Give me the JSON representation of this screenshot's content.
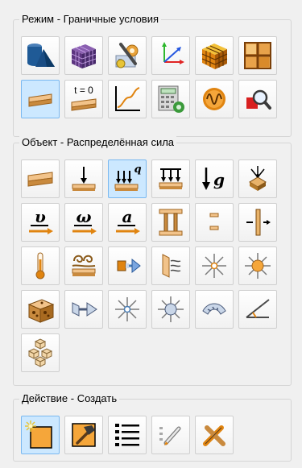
{
  "groups": {
    "mode": {
      "title": "Режим - Граничные условия",
      "buttons": [
        {
          "icon": "geometry-icon"
        },
        {
          "icon": "mesh-icon"
        },
        {
          "icon": "materials-icon"
        },
        {
          "icon": "coordinate-system-icon"
        },
        {
          "icon": "physics-cube-icon"
        },
        {
          "icon": "structure-grid-icon"
        },
        {
          "icon": "boundary-conditions-icon",
          "selected": true
        },
        {
          "icon": "initial-conditions-icon",
          "text": "t = 0"
        },
        {
          "icon": "results-graph-icon"
        },
        {
          "icon": "calculation-icon"
        },
        {
          "icon": "waves-icon"
        },
        {
          "icon": "search-results-icon"
        }
      ]
    },
    "object": {
      "title": "Объект - Распределённая сила",
      "buttons": [
        {
          "icon": "plate-load-icon"
        },
        {
          "icon": "point-force-icon"
        },
        {
          "icon": "distributed-force-icon",
          "text": "q",
          "selected": true
        },
        {
          "icon": "surface-pressure-icon"
        },
        {
          "icon": "gravity-icon",
          "text": "g"
        },
        {
          "icon": "node-support-icon"
        },
        {
          "icon": "velocity-icon",
          "text": "υ"
        },
        {
          "icon": "angular-velocity-icon",
          "text": "ω"
        },
        {
          "icon": "acceleration-icon",
          "text": "a"
        },
        {
          "icon": "column-support-icon"
        },
        {
          "icon": "link-icon"
        },
        {
          "icon": "axial-force-icon"
        },
        {
          "icon": "temperature-icon"
        },
        {
          "icon": "heat-flux-icon"
        },
        {
          "icon": "convection-icon"
        },
        {
          "icon": "radiation-icon"
        },
        {
          "icon": "point-heat-source-icon"
        },
        {
          "icon": "sun-source-icon"
        },
        {
          "icon": "volume-heat-icon"
        },
        {
          "icon": "flow-icon"
        },
        {
          "icon": "light-source-icon"
        },
        {
          "icon": "point-source-icon"
        },
        {
          "icon": "eye-symmetry-icon"
        },
        {
          "icon": "angle-measure-icon"
        },
        {
          "icon": "assembly-icon"
        }
      ]
    },
    "action": {
      "title": "Действие - Создать",
      "buttons": [
        {
          "icon": "create-icon",
          "selected": true
        },
        {
          "icon": "edit-hammer-icon"
        },
        {
          "icon": "list-icon"
        },
        {
          "icon": "properties-edit-icon"
        },
        {
          "icon": "delete-tools-icon"
        }
      ]
    }
  }
}
